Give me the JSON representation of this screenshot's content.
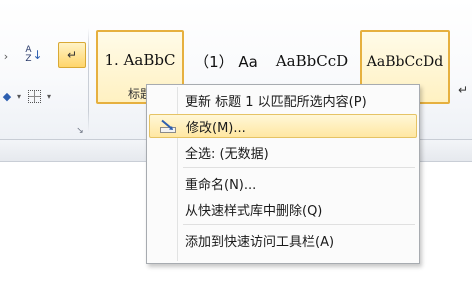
{
  "ribbon": {
    "paragraph_mark_glyph": "↵",
    "sort_glyph_top": "A",
    "sort_glyph_bottom": "Z"
  },
  "style_gallery": {
    "styles": [
      {
        "preview": "1. AaBbC",
        "name": "标题"
      },
      {
        "preview": "（1） Aa",
        "name": ""
      },
      {
        "preview": "AaBbCcD",
        "name": ""
      },
      {
        "preview": "AaBbCcDd",
        "name": ""
      },
      {
        "preview": "",
        "name": "↵"
      }
    ]
  },
  "context_menu": {
    "items": [
      {
        "label": "更新 标题 1 以匹配所选内容(P)",
        "icon": ""
      },
      {
        "label": "修改(M)...",
        "icon": "modify-style-icon",
        "highlighted": true
      },
      {
        "label": "全选: (无数据)",
        "icon": ""
      },
      {
        "label": "重命名(N)...",
        "icon": ""
      },
      {
        "label": "从快速样式库中删除(Q)",
        "icon": ""
      },
      {
        "label": "添加到快速访问工具栏(A)",
        "icon": ""
      }
    ]
  },
  "colors": {
    "highlight_fill": "#ffe7a2",
    "highlight_border": "#e5c365",
    "ribbon_bg": "#f9fafc"
  }
}
